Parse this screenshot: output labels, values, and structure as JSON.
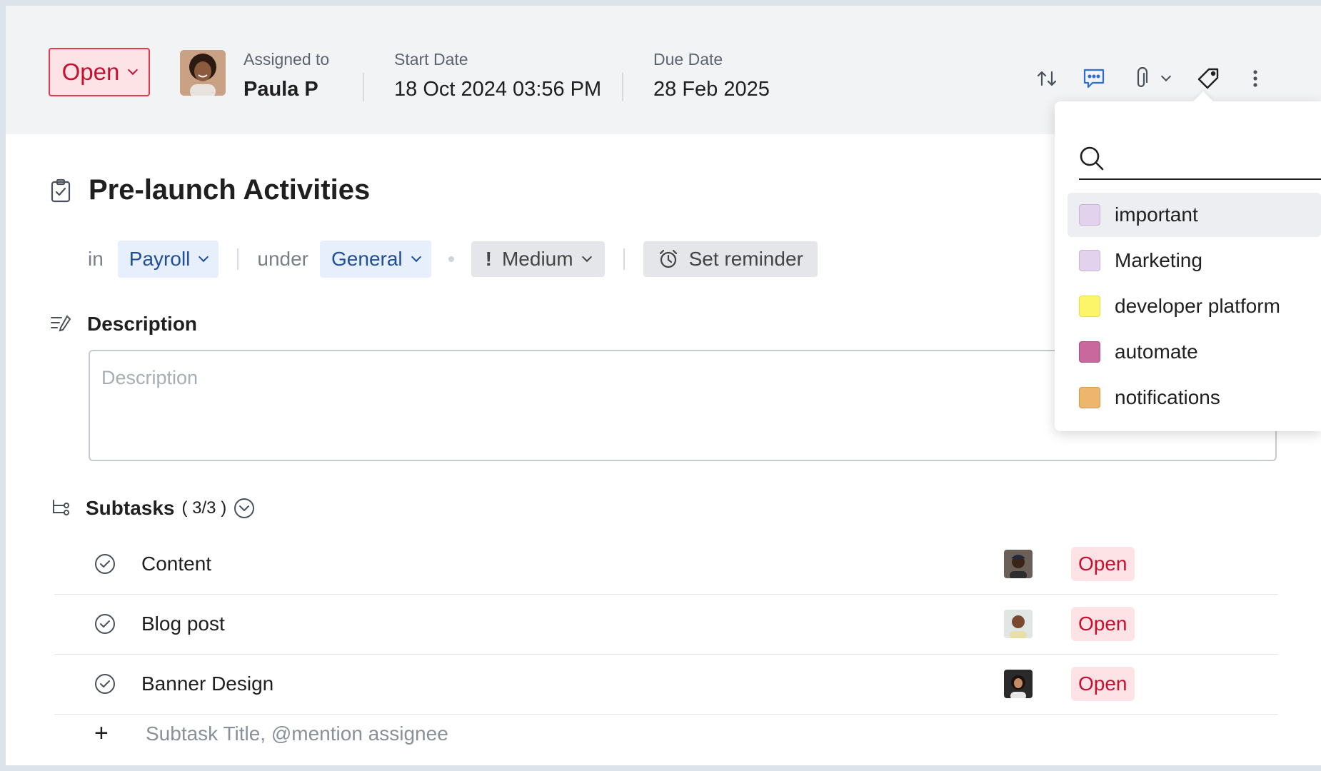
{
  "header": {
    "status": "Open",
    "assigned_label": "Assigned to",
    "assigned_value": "Paula P",
    "start_label": "Start Date",
    "start_value": "18 Oct 2024 03:56 PM",
    "due_label": "Due Date",
    "due_value": "28 Feb 2025"
  },
  "toolbar": {
    "icons": [
      "swap-icon",
      "comment-icon",
      "attachment-icon",
      "chevron-down-icon",
      "tag-icon",
      "more-vertical-icon"
    ]
  },
  "tags": {
    "search_placeholder": "",
    "items": [
      {
        "name": "important",
        "color": "#e3d2ee"
      },
      {
        "name": "Marketing",
        "color": "#e3d2ee"
      },
      {
        "name": "developer platform",
        "color": "#fcf56a"
      },
      {
        "name": "automate",
        "color": "#c8689d"
      },
      {
        "name": "notifications",
        "color": "#eeb56c"
      }
    ]
  },
  "task": {
    "title": "Pre-launch Activities",
    "in_label": "in",
    "project": "Payroll",
    "under_label": "under",
    "list": "General",
    "priority": "Medium",
    "reminder": "Set reminder"
  },
  "description": {
    "heading": "Description",
    "placeholder": "Description"
  },
  "subtasks": {
    "heading": "Subtasks",
    "count": "( 3/3 )",
    "items": [
      {
        "name": "Content",
        "status": "Open"
      },
      {
        "name": "Blog post",
        "status": "Open"
      },
      {
        "name": "Banner Design",
        "status": "Open"
      }
    ],
    "add_placeholder": "Subtask Title, @mention assignee",
    "add_symbol": "+"
  }
}
